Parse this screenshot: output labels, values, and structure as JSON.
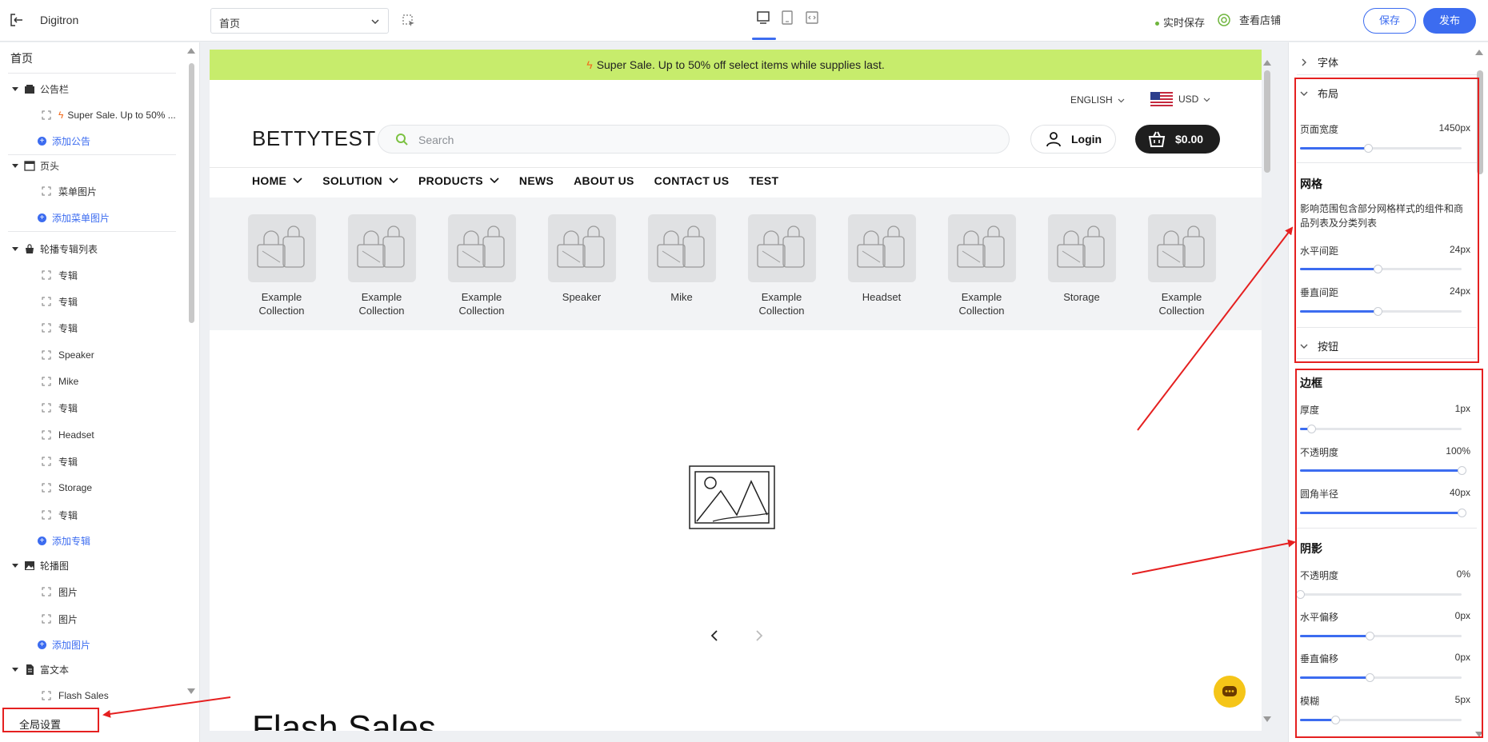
{
  "topbar": {
    "app_title": "Digitron",
    "page_select_value": "首页",
    "autosave": "实时保存",
    "view_store": "查看店铺",
    "save": "保存",
    "publish": "发布"
  },
  "sidebar": {
    "home": "首页",
    "groups": {
      "announce": "公告栏",
      "announce_item": "Super Sale. Up to 50% ...",
      "announce_add": "添加公告",
      "header": "页头",
      "header_item": "菜单图片",
      "header_add": "添加菜单图片",
      "carousel_list": "轮播专辑列表",
      "carousel_items": [
        "专辑",
        "专辑",
        "专辑",
        "Speaker",
        "Mike",
        "专辑",
        "Headset",
        "专辑",
        "Storage",
        "专辑"
      ],
      "carousel_add": "添加专辑",
      "slideshow": "轮播图",
      "slideshow_items": [
        "图片",
        "图片"
      ],
      "slideshow_add": "添加图片",
      "richtext": "富文本",
      "richtext_item": "Flash Sales"
    },
    "global_settings": "全局设置"
  },
  "preview": {
    "announcement": "Super Sale. Up to 50% off select items while supplies last.",
    "language": "ENGLISH",
    "currency": "USD",
    "brand": "BETTYTEST",
    "search_placeholder": "Search",
    "login": "Login",
    "cart_total": "$0.00",
    "nav": [
      "HOME",
      "SOLUTION",
      "PRODUCTS",
      "NEWS",
      "ABOUT US",
      "CONTACT US",
      "TEST"
    ],
    "collections": [
      [
        "Example",
        "Collection"
      ],
      [
        "Example",
        "Collection"
      ],
      [
        "Example",
        "Collection"
      ],
      [
        "Speaker",
        ""
      ],
      [
        "Mike",
        ""
      ],
      [
        "Example",
        "Collection"
      ],
      [
        "Headset",
        ""
      ],
      [
        "Example",
        "Collection"
      ],
      [
        "Storage",
        ""
      ],
      [
        "Example",
        "Collection"
      ]
    ],
    "flash_title": "Flash Sales"
  },
  "settings": {
    "font_section": "字体",
    "layout_section": "布局",
    "page_width_label": "页面宽度",
    "page_width_value": "1450px",
    "page_width_ratio": 0.42,
    "grid_title": "网格",
    "grid_desc": "影响范围包含部分网格样式的组件和商品列表及分类列表",
    "h_gap_label": "水平间距",
    "h_gap_value": "24px",
    "h_gap_ratio": 0.48,
    "v_gap_label": "垂直间距",
    "v_gap_value": "24px",
    "v_gap_ratio": 0.48,
    "button_section": "按钮",
    "border_title": "边框",
    "thickness_label": "厚度",
    "thickness_value": "1px",
    "thickness_ratio": 0.07,
    "opacity_label": "不透明度",
    "opacity_value": "100%",
    "opacity_ratio": 1.0,
    "radius_label": "圆角半径",
    "radius_value": "40px",
    "radius_ratio": 1.0,
    "shadow_title": "阴影",
    "shadow_opacity_label": "不透明度",
    "shadow_opacity_value": "0%",
    "shadow_opacity_ratio": 0.0,
    "h_offset_label": "水平偏移",
    "h_offset_value": "0px",
    "h_offset_ratio": 0.43,
    "v_offset_label": "垂直偏移",
    "v_offset_value": "0px",
    "v_offset_ratio": 0.43,
    "blur_label": "模糊",
    "blur_value": "5px",
    "blur_ratio": 0.22
  },
  "colors": {
    "accent": "#3c6cf0",
    "announce_bg": "#c7ec6c",
    "annotation_red": "#e52020",
    "chat_yellow": "#f5c518"
  }
}
